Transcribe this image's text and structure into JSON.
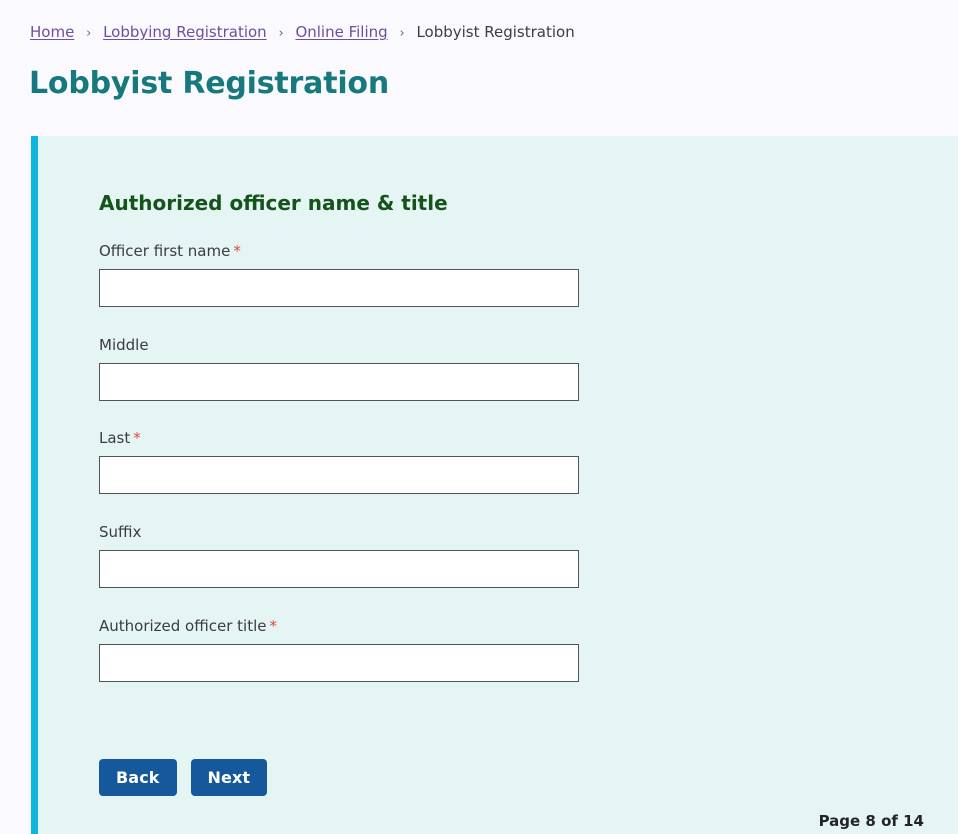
{
  "breadcrumb": {
    "separator": "›",
    "items": [
      {
        "label": "Home",
        "is_link": true
      },
      {
        "label": "Lobbying Registration",
        "is_link": true
      },
      {
        "label": "Online Filing",
        "is_link": true
      },
      {
        "label": "Lobbyist Registration",
        "is_link": false
      }
    ]
  },
  "page": {
    "title": "Lobbyist Registration"
  },
  "form": {
    "section_title": "Authorized officer name & title",
    "required_marker": "*",
    "fields": [
      {
        "label": "Officer first name",
        "required": true,
        "value": "",
        "placeholder": ""
      },
      {
        "label": "Middle",
        "required": false,
        "value": "",
        "placeholder": ""
      },
      {
        "label": "Last",
        "required": true,
        "value": "",
        "placeholder": ""
      },
      {
        "label": "Suffix",
        "required": false,
        "value": "",
        "placeholder": ""
      },
      {
        "label": "Authorized officer title",
        "required": true,
        "value": "",
        "placeholder": ""
      }
    ],
    "buttons": {
      "back_label": "Back",
      "next_label": "Next"
    },
    "pagination": "Page 8 of 14"
  },
  "colors": {
    "page_background": "#faf9fd",
    "panel_background": "#e5f5f3",
    "panel_accent": "#0cb6dd",
    "page_title": "#15797d",
    "section_title": "#14541a",
    "link": "#6f4e9c",
    "required_asterisk": "#e2483a",
    "button": "#15599c",
    "input_border": "#4c555c"
  }
}
